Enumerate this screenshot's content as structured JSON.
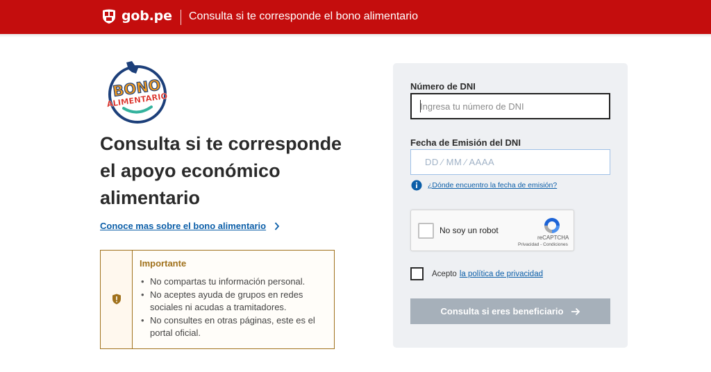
{
  "header": {
    "brand": "gob.pe",
    "title": "Consulta si te corresponde el bono alimentario",
    "background_color": "#c40d0d"
  },
  "logo": {
    "line1": "BONO",
    "line2": "ALIMENTARIO",
    "colors": {
      "navy": "#1c3f7a",
      "orange": "#f19a1f",
      "red": "#d9251d",
      "teal": "#33b29d"
    }
  },
  "main": {
    "title": "Consulta si te corresponde el apoyo económico alimentario",
    "more_link": "Conoce mas sobre el bono alimentario",
    "more_link_icon": "chevron-right-icon"
  },
  "notice": {
    "icon": "shield-icon",
    "title": "Importante",
    "items": [
      "No compartas tu información personal.",
      "No aceptes ayuda de grupos en redes sociales ni acudas a tramitadores.",
      "No consultes en otras páginas, este es el portal oficial."
    ],
    "accent_color": "#a0711b"
  },
  "form": {
    "dni_label": "Número de DNI",
    "dni_placeholder": "Ingresa tu número de DNI",
    "date_label": "Fecha de Emisión del DNI",
    "date_placeholder": "DD ⁄ MM ⁄ AAAA",
    "help_icon": "info-icon",
    "help_link": "¿Dónde encuentro la fecha de emisión?",
    "captcha": {
      "label": "No soy un robot",
      "brand": "reCAPTCHA",
      "terms": "Privacidad - Condiciones"
    },
    "accept_text": "Acepto",
    "accept_link": "la política de privacidad",
    "submit_label": "Consulta si eres beneficiario",
    "submit_icon": "arrow-right-icon",
    "link_color": "#0b5ea8",
    "disabled_button_color": "#a6b0ba"
  }
}
